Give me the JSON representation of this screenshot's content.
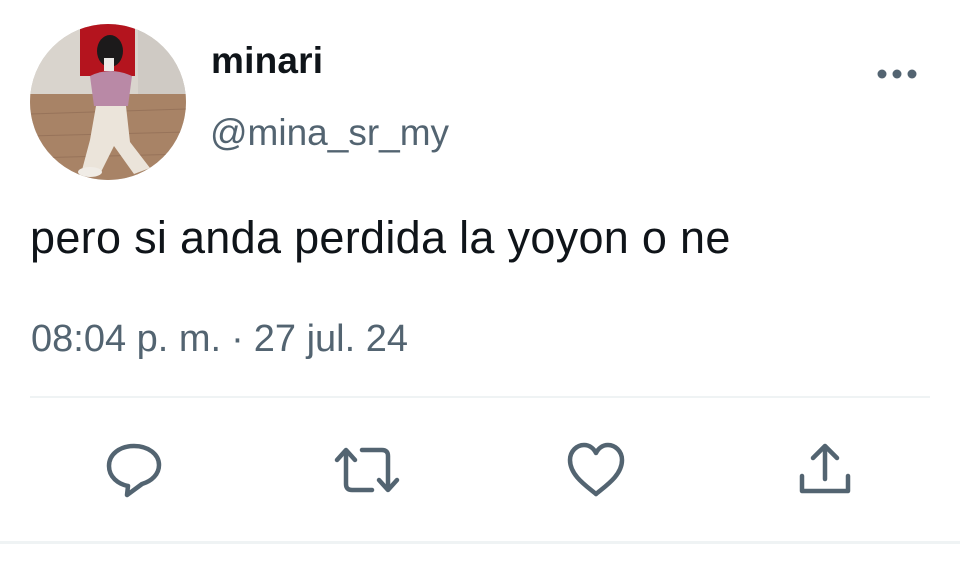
{
  "tweet": {
    "display_name": "minari",
    "handle": "@mina_sr_my",
    "text": "pero si anda perdida la yoyon o ne",
    "time": "08:04 p. m.",
    "separator": "·",
    "date": "27 jul. 24"
  },
  "icons": {
    "more": "more-horizontal-icon",
    "reply": "reply-icon",
    "retweet": "retweet-icon",
    "like": "like-icon",
    "share": "share-icon"
  },
  "colors": {
    "text_primary": "#0f1419",
    "text_secondary": "#536471",
    "icon": "#536471",
    "divider": "#eff3f4"
  }
}
